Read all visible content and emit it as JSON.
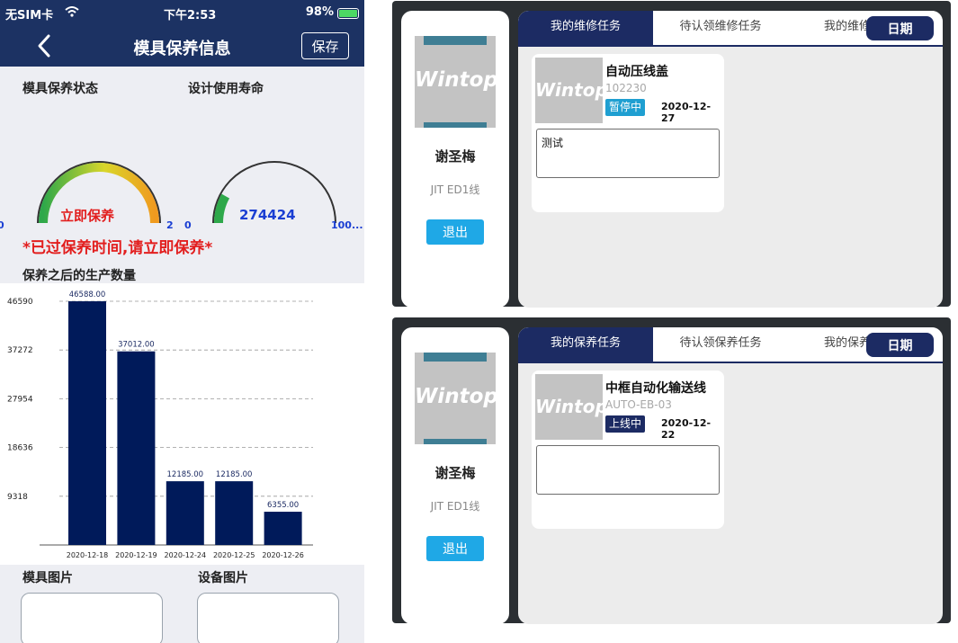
{
  "phone": {
    "status": {
      "carrier": "无SIM卡",
      "time": "下午2:53",
      "battery": "98%",
      "battery_level": 0.98
    },
    "nav": {
      "title": "模具保养信息",
      "save_label": "保存"
    },
    "labels": {
      "maintenance_status": "模具保养状态",
      "design_life": "设计使用寿命",
      "production_since": "保养之后的生产数量",
      "mold_image": "模具图片",
      "equipment_image": "设备图片"
    },
    "gauge1": {
      "min_label": "0",
      "max_label": "2",
      "value_text": "立即保养",
      "fill": 1.0
    },
    "gauge2": {
      "min_label": "0",
      "max_label": "100...",
      "value_text": "274424",
      "fill": 0.16
    },
    "warning": "*已过保养时间,请立即保养*",
    "colors": {
      "navy": "#1c3263",
      "bar": "#001a5a",
      "warning": "#e21e1e",
      "gauge_value2": "#1a3ed3"
    }
  },
  "chart_data": {
    "type": "bar",
    "categories": [
      "2020-12-18",
      "2020-12-19",
      "2020-12-24",
      "2020-12-25",
      "2020-12-26"
    ],
    "values": [
      46588.0,
      37012.0,
      12185.0,
      12185.0,
      6355.0
    ],
    "value_labels": [
      "46588.00",
      "37012.00",
      "12185.00",
      "12185.00",
      "6355.00"
    ],
    "yticks": [
      9318,
      18636,
      27954,
      37272,
      46590
    ],
    "ylim": [
      0,
      46590
    ],
    "grid": true,
    "title": "",
    "xlabel": "",
    "ylabel": ""
  },
  "tablets": [
    {
      "user": {
        "name": "谢圣梅",
        "line": "JIT ED1线",
        "logo": "Wintop"
      },
      "exit_label": "退出",
      "tabs": [
        "我的维修任务",
        "待认领维修任务",
        "我的维修"
      ],
      "active_tab": 0,
      "date_label": "日期",
      "task": {
        "title": "自动压线盖",
        "code": "102230",
        "status": "暂停中",
        "status_color": "#1f9fd1",
        "date": "2020-12-27",
        "note": "测试",
        "logo": "Wintop"
      }
    },
    {
      "user": {
        "name": "谢圣梅",
        "line": "JIT ED1线",
        "logo": "Wintop"
      },
      "exit_label": "退出",
      "tabs": [
        "我的保养任务",
        "待认领保养任务",
        "我的保养"
      ],
      "active_tab": 0,
      "date_label": "日期",
      "task": {
        "title": "中框自动化输送线",
        "code": "AUTO-EB-03",
        "status": "上线中",
        "status_color": "#1c2b63",
        "date": "2020-12-22",
        "note": "",
        "logo": "Wintop"
      }
    }
  ]
}
